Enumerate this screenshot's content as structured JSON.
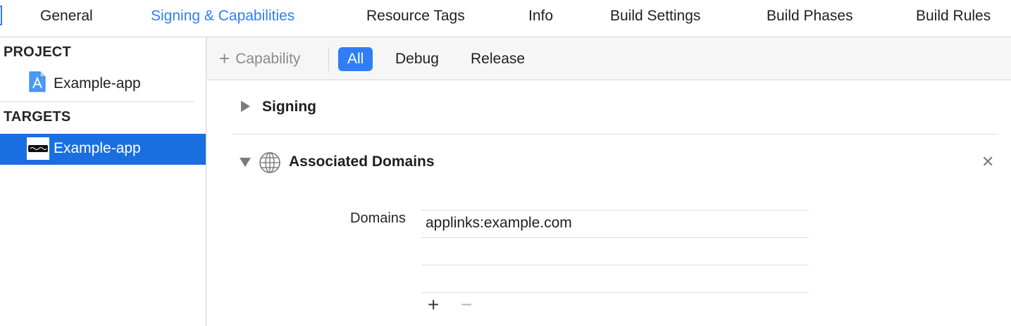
{
  "tabs": [
    {
      "label": "General",
      "active": false
    },
    {
      "label": "Signing & Capabilities",
      "active": true
    },
    {
      "label": "Resource Tags",
      "active": false
    },
    {
      "label": "Info",
      "active": false
    },
    {
      "label": "Build Settings",
      "active": false
    },
    {
      "label": "Build Phases",
      "active": false
    },
    {
      "label": "Build Rules",
      "active": false
    }
  ],
  "sidebar": {
    "project_header": "PROJECT",
    "project_item": "Example-app",
    "targets_header": "TARGETS",
    "target_item": "Example-app",
    "selected": "target"
  },
  "toolbar": {
    "add_capability": "Capability",
    "add_icon": "plus-icon",
    "filters": [
      "All",
      "Debug",
      "Release"
    ],
    "active_filter": "All"
  },
  "sections": {
    "signing": {
      "title": "Signing",
      "expanded": false
    },
    "associated_domains": {
      "title": "Associated Domains",
      "expanded": true,
      "icon": "globe-icon",
      "domains_label": "Domains",
      "domains": [
        "applinks:example.com",
        "",
        ""
      ],
      "add_icon": "plus-icon",
      "remove_icon": "minus-icon"
    }
  },
  "colors": {
    "accent": "#2f7ef7",
    "selection": "#1a6fe0",
    "disabled_text": "#8a8a8a"
  }
}
